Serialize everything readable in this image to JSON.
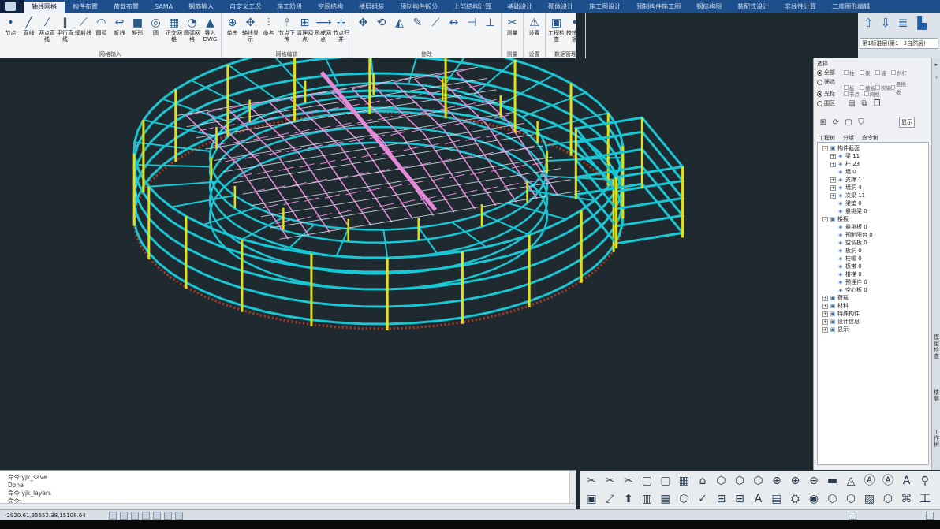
{
  "tabs": [
    {
      "label": "轴线网格",
      "active": true
    },
    {
      "label": "构件布置"
    },
    {
      "label": "荷载布置"
    },
    {
      "label": "SAMA"
    },
    {
      "label": "钢筋输入"
    },
    {
      "label": "自定义工况"
    },
    {
      "label": "施工阶段"
    },
    {
      "label": "空间结构"
    },
    {
      "label": "楼层组装"
    },
    {
      "label": "预制构件拆分"
    },
    {
      "label": "上部结构计算"
    },
    {
      "label": "基础设计"
    },
    {
      "label": "砌体设计"
    },
    {
      "label": "施工图设计"
    },
    {
      "label": "预制构件施工图"
    },
    {
      "label": "钢结构图"
    },
    {
      "label": "装配式设计"
    },
    {
      "label": "非线性计算"
    },
    {
      "label": "二维图形编辑"
    }
  ],
  "ribbon": {
    "groups": [
      {
        "title": "网格输入",
        "buttons": [
          "节点",
          "直线",
          "两点直线",
          "平行直线",
          "辐射线",
          "圆弧",
          "折线",
          "矩形",
          "圆",
          "正交网格",
          "圆弧网格",
          "导入DWG"
        ]
      },
      {
        "title": "网格编辑",
        "buttons": [
          "单击",
          "轴线显示",
          "命名",
          "节点下传",
          "清理网点",
          "形成网点",
          "节点归并"
        ]
      },
      {
        "title": "修改",
        "buttons": [
          "",
          "",
          "",
          "",
          "",
          "",
          "",
          ""
        ]
      },
      {
        "title": "测量",
        "buttons": [
          "测量"
        ]
      },
      {
        "title": "设置",
        "buttons": [
          "设置"
        ]
      },
      {
        "title": "数据管理",
        "buttons": [
          "工程检查",
          "校核数据"
        ]
      }
    ]
  },
  "rtop": {
    "combo_value": "第1标准层(第1~3自然层)"
  },
  "panel": {
    "title": "选择",
    "radios_top": [
      "全部",
      "筛选"
    ],
    "checks_row1": [
      "柱",
      "梁",
      "墙",
      "斜杆"
    ],
    "checks_row2": [
      "板",
      "楼板",
      "次梁",
      "悬挑板"
    ],
    "radios_mid": [
      "光标",
      "围区"
    ],
    "checks_row3": [
      "节点",
      "网格"
    ],
    "show_label": "显示",
    "tabs": [
      "工程树",
      "分组",
      "命令树"
    ]
  },
  "tree": [
    {
      "label": "构件截面",
      "level": 0,
      "exp": "-"
    },
    {
      "label": "梁 11",
      "level": 1,
      "exp": "+"
    },
    {
      "label": "柱 23",
      "level": 1,
      "exp": "+"
    },
    {
      "label": "墙 0",
      "level": 1,
      "exp": ""
    },
    {
      "label": "支撑 1",
      "level": 1,
      "exp": "+"
    },
    {
      "label": "墙洞 4",
      "level": 1,
      "exp": "+"
    },
    {
      "label": "次梁 11",
      "level": 1,
      "exp": "+"
    },
    {
      "label": "梁垫 0",
      "level": 1,
      "exp": ""
    },
    {
      "label": "悬挑梁 0",
      "level": 1,
      "exp": ""
    },
    {
      "label": "楼板",
      "level": 0,
      "exp": "-"
    },
    {
      "label": "悬挑板 0",
      "level": 1,
      "exp": ""
    },
    {
      "label": "预制阳台 0",
      "level": 1,
      "exp": ""
    },
    {
      "label": "空调板 0",
      "level": 1,
      "exp": ""
    },
    {
      "label": "板洞 0",
      "level": 1,
      "exp": ""
    },
    {
      "label": "柱帽 0",
      "level": 1,
      "exp": ""
    },
    {
      "label": "板带 0",
      "level": 1,
      "exp": ""
    },
    {
      "label": "楼梯 0",
      "level": 1,
      "exp": ""
    },
    {
      "label": "预埋件 0",
      "level": 1,
      "exp": ""
    },
    {
      "label": "空心板 0",
      "level": 1,
      "exp": ""
    },
    {
      "label": "荷载",
      "level": 0,
      "exp": "+"
    },
    {
      "label": "材料",
      "level": 0,
      "exp": "+"
    },
    {
      "label": "特殊构件",
      "level": 0,
      "exp": "+"
    },
    {
      "label": "设计信息",
      "level": 0,
      "exp": "+"
    },
    {
      "label": "显示",
      "level": 0,
      "exp": "+"
    }
  ],
  "command_lines": [
    "命令:yjk_save",
    "Done",
    "命令:yjk_layers",
    "命令:"
  ],
  "status": {
    "coords": "-2920.61,35552.38,15108.64"
  },
  "side_strip": {
    "top_text": "模型检查",
    "mid_text": "楼层",
    "bottom_text": "工作树"
  },
  "colors": {
    "beam": "#19c6d4",
    "column": "#e4e016",
    "truss": "#e58ad8",
    "roof_grid": "#d9e4ee",
    "base": "#b43820",
    "viewport_bg": "#1e2a30"
  }
}
